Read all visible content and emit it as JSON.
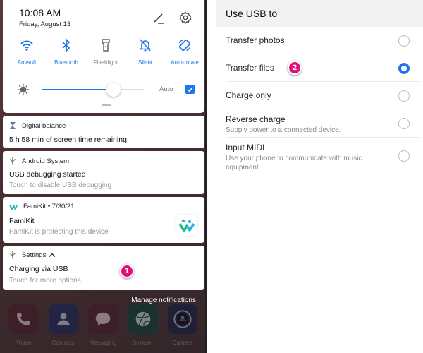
{
  "left_panel": {
    "status": {
      "time": "10:08 AM",
      "date": "Friday, August 13"
    },
    "header_icons": [
      "edit-icon",
      "settings-gear-icon"
    ],
    "quick_tiles": [
      {
        "label": "Anvsoft",
        "icon": "wifi-icon",
        "active": true
      },
      {
        "label": "Bluetooth",
        "icon": "bluetooth-icon",
        "active": true
      },
      {
        "label": "Flashlight",
        "icon": "flashlight-icon",
        "active": false
      },
      {
        "label": "Silent",
        "icon": "bell-off-icon",
        "active": true
      },
      {
        "label": "Auto-rotate",
        "icon": "rotate-icon",
        "active": true
      }
    ],
    "brightness": {
      "level": 0.7,
      "auto_label": "Auto",
      "auto_checked": true
    },
    "notifications": [
      {
        "app": "Digital balance",
        "icon": "hourglass-icon",
        "title": "5 h 58 min of screen time remaining",
        "subtitle": ""
      },
      {
        "app": "Android System",
        "icon": "usb-icon",
        "title": "USB debugging started",
        "subtitle": "Touch to disable USB debugging"
      },
      {
        "app": "FamiKit • 7/30/21",
        "icon": "famikit-icon",
        "title": "FamiKit",
        "subtitle": "FamiKit is protecting this device"
      },
      {
        "app": "Settings",
        "icon": "usb-icon",
        "title": "Charging via USB",
        "subtitle": "Touch for more options",
        "expanded": true
      }
    ],
    "step_marker_1": "1",
    "manage_label": "Manage notifications",
    "dock": [
      {
        "label": "Phone",
        "icon": "phone-icon"
      },
      {
        "label": "Contacts",
        "icon": "contacts-icon"
      },
      {
        "label": "Messaging",
        "icon": "messaging-icon"
      },
      {
        "label": "Browser",
        "icon": "browser-icon"
      },
      {
        "label": "Camera",
        "icon": "camera-icon"
      }
    ]
  },
  "right_panel": {
    "title": "Use USB to",
    "options": [
      {
        "label": "Transfer photos",
        "description": "",
        "selected": false
      },
      {
        "label": "Transfer files",
        "description": "",
        "selected": true
      },
      {
        "label": "Charge only",
        "description": "",
        "selected": false
      },
      {
        "label": "Reverse charge",
        "description": "Supply power to a connected device.",
        "selected": false
      },
      {
        "label": "Input MIDI",
        "description": "Use your phone to communicate with music equipment.",
        "selected": false
      }
    ],
    "step_marker_2": "2"
  },
  "colors": {
    "accent": "#1e77e8",
    "marker": "#e0127a"
  }
}
